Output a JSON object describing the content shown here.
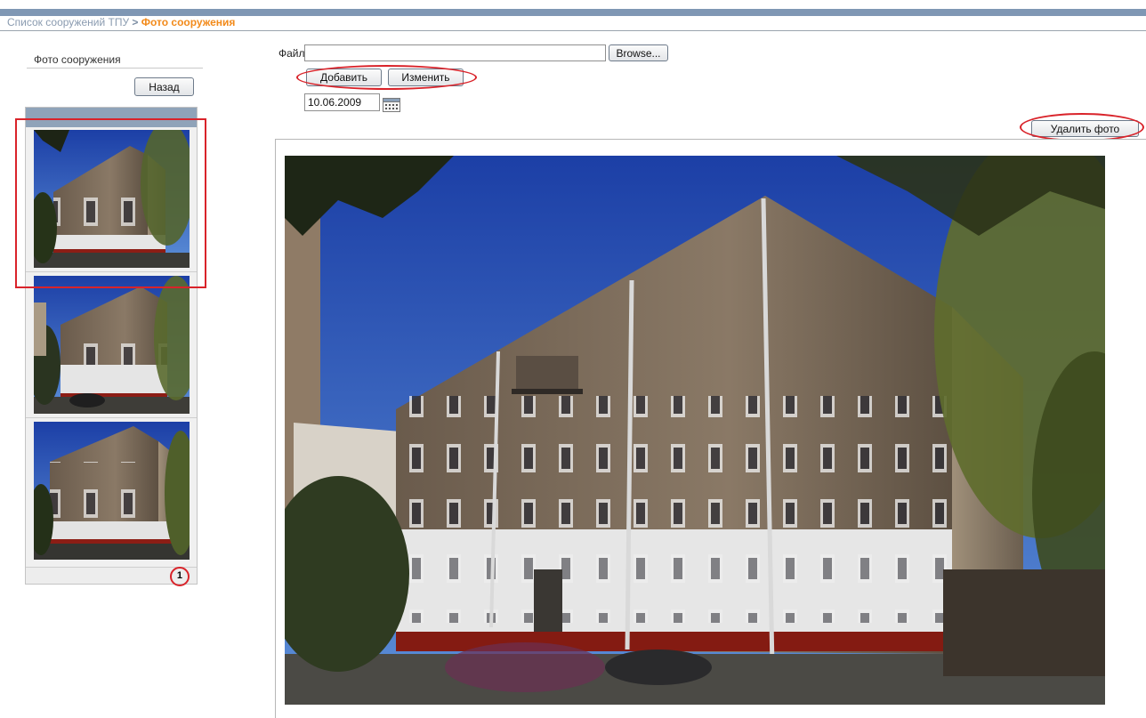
{
  "breadcrumb": {
    "parent": "Список сооружений ТПУ",
    "separator": " > ",
    "current": "Фото сооружения"
  },
  "sidebar": {
    "title": "Фото сооружения",
    "back_label": "Назад"
  },
  "gallery": {
    "pager": {
      "current": "1"
    }
  },
  "form": {
    "file_label": "Файл",
    "file_value": "",
    "browse_label": "Browse...",
    "add_label": "Добавить",
    "change_label": "Изменить",
    "date_value": "10.06.2009",
    "delete_label": "Удалить фото"
  },
  "icons": {
    "calendar": "calendar-icon"
  },
  "colors": {
    "accent": "#f28a1a",
    "header_bar": "#7f97b4",
    "highlight": "#d9232a",
    "link": "#8a9bb0"
  }
}
